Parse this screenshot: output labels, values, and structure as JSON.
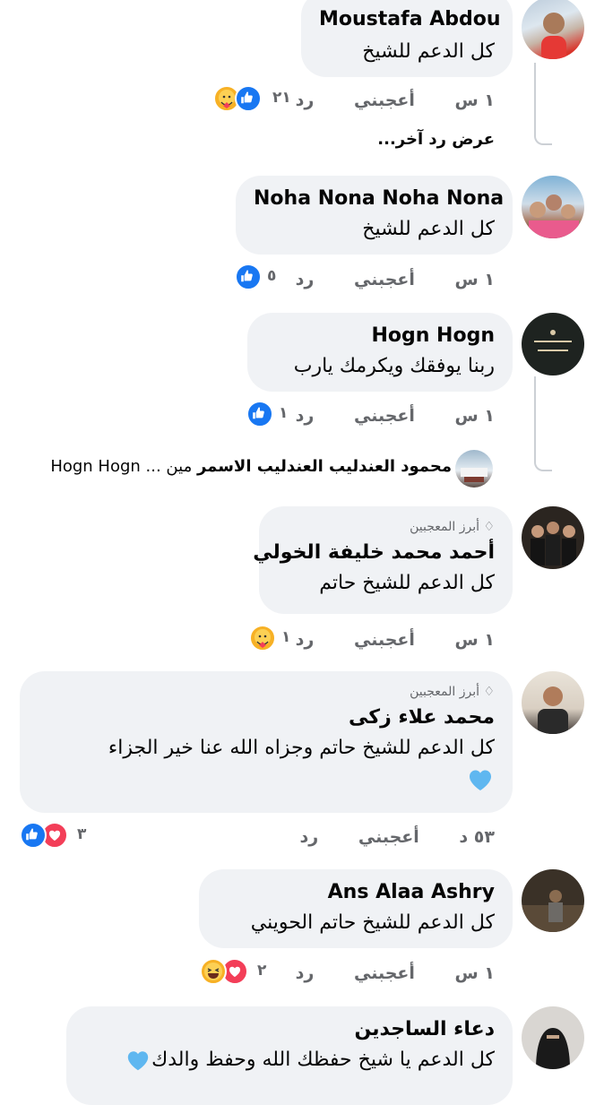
{
  "colors": {
    "bubble": "#f0f2f5",
    "meta": "#65676b",
    "like": "#1877f2",
    "love": "#f33e58",
    "thread": "#ccd0d5"
  },
  "labels": {
    "like": "أعجبني",
    "reply": "رد",
    "top_fan": "أبرز المعجبين"
  },
  "comments": [
    {
      "name": "Moustafa Abdou",
      "text": "كل الدعم للشيخ",
      "time": "١ س",
      "reactions_count": "٢١",
      "reaction_icons": [
        "like-icon",
        "care-icon"
      ]
    },
    {
      "name": "Noha Nona Noha Nona",
      "text": "كل الدعم  للشيخ",
      "time": "١ س",
      "reactions_count": "٥",
      "reaction_icons": [
        "like-icon"
      ]
    },
    {
      "name": "Hogn Hogn",
      "text": "ربنا يوفقك ويكرمك يارب",
      "time": "١ س",
      "reactions_count": "١",
      "reaction_icons": [
        "like-icon"
      ]
    },
    {
      "name": "أحمد محمد خليفة الخولي",
      "text": "كل الدعم  للشيخ حاتم",
      "time": "١ س",
      "reactions_count": "١",
      "reaction_icons": [
        "care-icon"
      ],
      "top_fan": true
    },
    {
      "name": "محمد علاء زكى",
      "text": "كل الدعم للشيخ حاتم وجزاه الله عنا خير الجزاء",
      "time": "٥٣ د",
      "reactions_count": "٣",
      "reaction_icons": [
        "like-icon",
        "love-icon"
      ],
      "top_fan": true
    },
    {
      "name": "Ans Alaa Ashry",
      "text": "كل الدعم للشيخ حاتم الحويني",
      "time": "١ س",
      "reactions_count": "٢",
      "reaction_icons": [
        "love-icon",
        "haha-icon"
      ]
    },
    {
      "name": "دعاء الساجدين",
      "text": "كل الدعم يا شيخ حفظك الله وحفظ والدك"
    }
  ],
  "replies": {
    "view_more": "عرض رد آخر...",
    "reply_preview_name": "محمود العندليب العندليب الاسمر",
    "reply_preview_text": "مين ... Hogn Hogn"
  }
}
